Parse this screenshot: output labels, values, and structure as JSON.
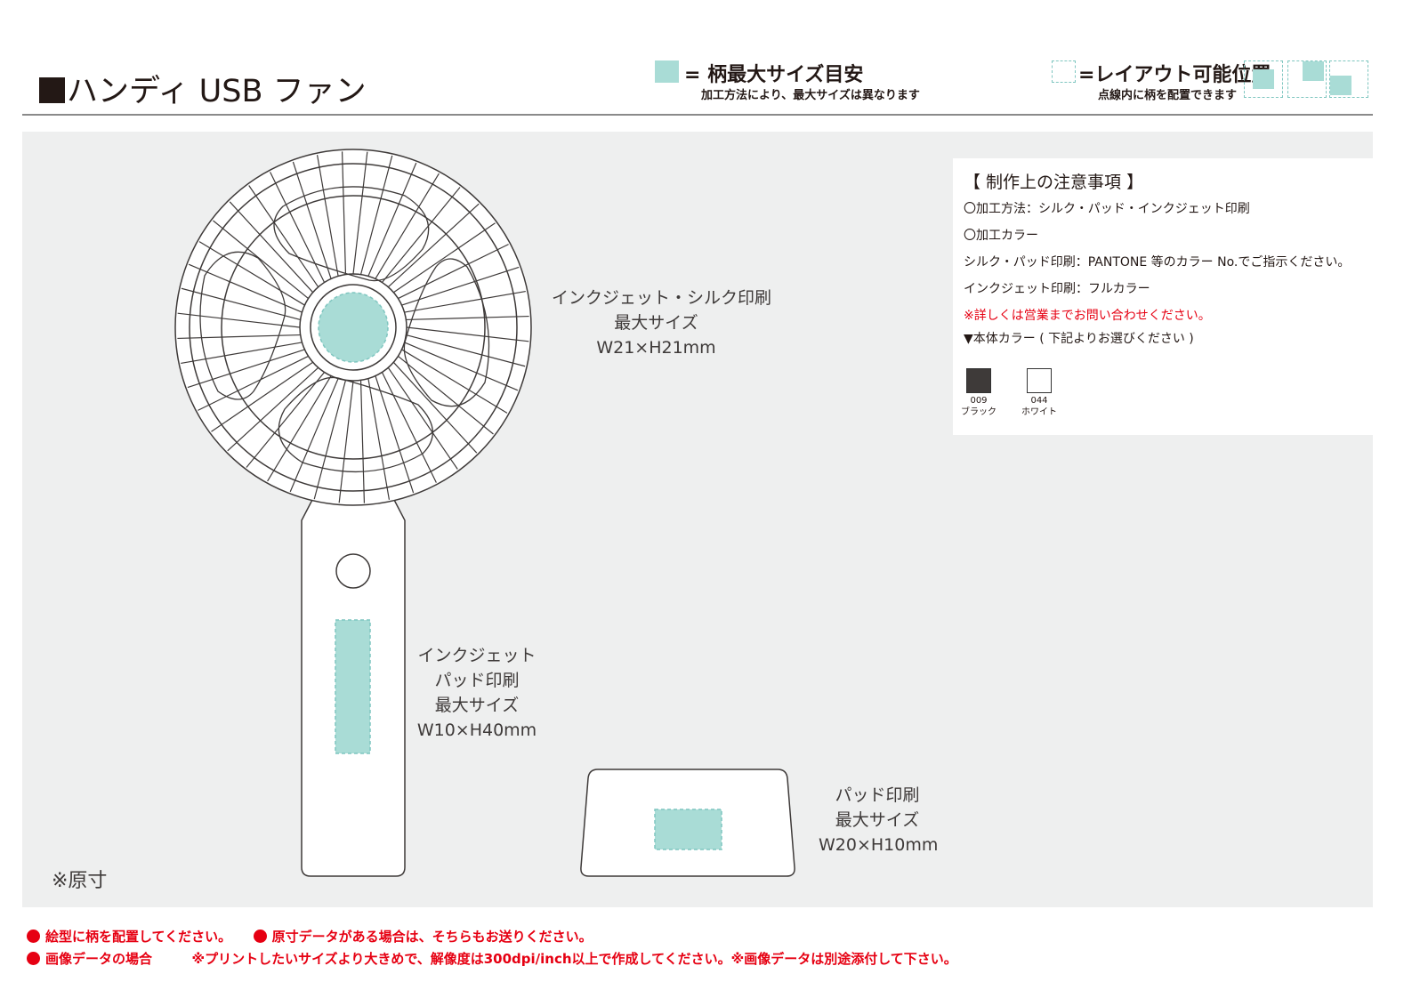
{
  "header": {
    "title": "ハンディ USB ファン",
    "legend_max": "= 柄最大サイズ目安",
    "legend_max_sub": "加工方法により、最大サイズは異なります",
    "legend_layout": "=レイアウト可能位置",
    "legend_layout_sub": "点線内に柄を配置できます"
  },
  "colors": {
    "print_area": "#a9dcd6",
    "print_border": "#7fc6c0",
    "panel_bg": "#eeefef",
    "accent_red": "#e60012"
  },
  "notes": {
    "heading": "【 制作上の注意事項 】",
    "method": "〇加工方法：シルク・パッド・インクジェット印刷",
    "color_heading": "〇加工カラー",
    "silk_pad": "シルク・パッド印刷：PANTONE 等のカラー No.でご指示ください。",
    "inkjet": "インクジェット印刷：フルカラー",
    "warning": "※詳しくは営業までお問い合わせください。",
    "body_color": "▼本体カラー ( 下記よりお選びください )",
    "swatches": [
      {
        "code": "009",
        "name": "ブラック",
        "color": "#3e3a39"
      },
      {
        "code": "044",
        "name": "ホワイト",
        "color": "#ffffff"
      }
    ]
  },
  "areas": {
    "fan": {
      "line1": "インクジェット・シルク印刷",
      "line2": "最大サイズ",
      "line3": "W21×H21mm"
    },
    "handle": {
      "line1": "インクジェット",
      "line2": "パッド印刷",
      "line3": "最大サイズ",
      "line4": "W10×H40mm"
    },
    "stand": {
      "line1": "パッド印刷",
      "line2": "最大サイズ",
      "line3": "W20×H10mm"
    }
  },
  "scale_note": "※原寸",
  "footer": {
    "line1_a": "絵型に柄を配置してください。",
    "line1_b": "原寸データがある場合は、そちらもお送りください。",
    "line2_a": "画像データの場合",
    "line2_b": "※プリントしたいサイズより大きめで、解像度は300dpi/inch以上で作成してください。※画像データは別途添付して下さい。"
  }
}
